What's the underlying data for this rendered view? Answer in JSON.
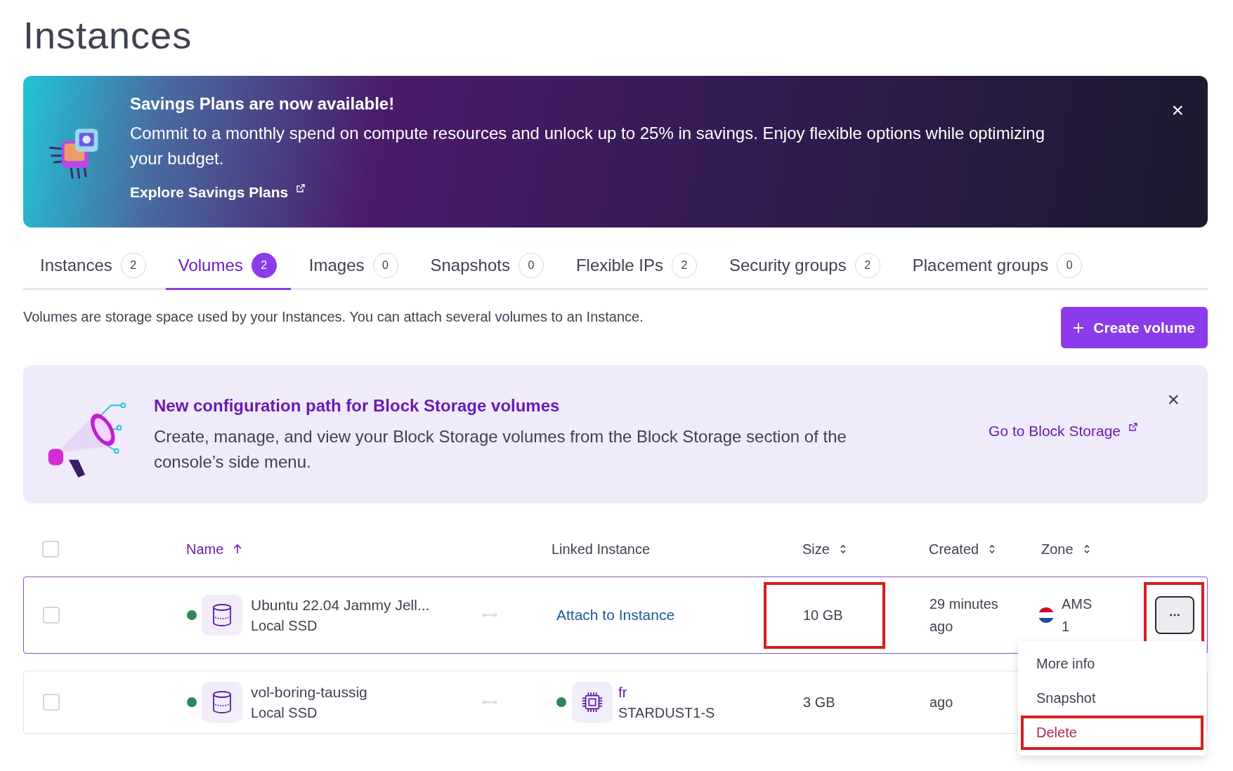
{
  "page_title": "Instances",
  "promo": {
    "title": "Savings Plans are now available!",
    "text": "Commit to a monthly spend on compute resources and unlock up to 25% in savings. Enjoy flexible options while optimizing your budget.",
    "link": "Explore Savings Plans",
    "close": "×"
  },
  "tabs": [
    {
      "label": "Instances",
      "count": "2",
      "selected": false
    },
    {
      "label": "Volumes",
      "count": "2",
      "selected": true
    },
    {
      "label": "Images",
      "count": "0",
      "selected": false
    },
    {
      "label": "Snapshots",
      "count": "0",
      "selected": false
    },
    {
      "label": "Flexible IPs",
      "count": "2",
      "selected": false
    },
    {
      "label": "Security groups",
      "count": "2",
      "selected": false
    },
    {
      "label": "Placement groups",
      "count": "0",
      "selected": false
    }
  ],
  "description": "Volumes are storage space used by your Instances. You can attach several volumes to an Instance.",
  "create_button": "Create volume",
  "notice": {
    "title": "New configuration path for Block Storage volumes",
    "text": "Create, manage, and view your Block Storage volumes from the Block Storage section of the console’s side menu.",
    "link": "Go to Block Storage",
    "close": "×"
  },
  "table": {
    "select_all_checked": false,
    "columns": [
      "Name",
      "Linked Instance",
      "Size",
      "Created",
      "Zone"
    ],
    "rows": [
      {
        "checked": false,
        "online": true,
        "name": "Ubuntu 22.04 Jammy Jell...",
        "type": "Local SSD",
        "linked": {
          "kind": "action",
          "label": "Attach to Instance"
        },
        "size": "10 GB",
        "size_highlighted": true,
        "created": "29 minutes ago",
        "zone": "AMS 1",
        "actions_visible": true,
        "more_highlighted": true,
        "selected": true
      },
      {
        "checked": false,
        "online": true,
        "name": "vol-boring-taussig",
        "type": "Local SSD",
        "linked": {
          "kind": "instance",
          "name": "fr",
          "type": "STARDUST1-S",
          "online": true
        },
        "size": "3 GB",
        "size_highlighted": false,
        "created": "ago",
        "actions_visible": false,
        "selected": false
      }
    ]
  },
  "row_menu": {
    "items": [
      {
        "label": "More info",
        "kind": "normal",
        "highlighted": false
      },
      {
        "label": "Snapshot",
        "kind": "normal",
        "highlighted": false
      },
      {
        "label": "Delete",
        "kind": "danger",
        "highlighted": true
      }
    ]
  }
}
